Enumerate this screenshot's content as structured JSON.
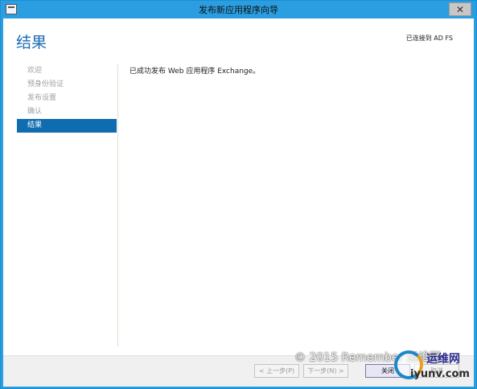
{
  "window": {
    "title": "发布新应用程序向导",
    "close_glyph": "✕"
  },
  "header": {
    "page_title": "结果",
    "connection_status": "已连接到 AD FS"
  },
  "nav": {
    "items": [
      {
        "label": "欢迎",
        "active": false
      },
      {
        "label": "预身份验证",
        "active": false
      },
      {
        "label": "发布设置",
        "active": false
      },
      {
        "label": "确认",
        "active": false
      },
      {
        "label": "结果",
        "active": true
      }
    ]
  },
  "main": {
    "message": "已成功发布 Web 应用程序 Exchange。"
  },
  "footer": {
    "prev_label": "< 上一步(P)",
    "next_label": "下一步(N) >",
    "close_label": "关闭",
    "cancel_label": "取消"
  },
  "watermark": {
    "text": "© 2015 Remember 运维网",
    "logo_cn": "运维网",
    "logo_url": "iyunv.com"
  },
  "colors": {
    "accent": "#0f6cb0",
    "title_blue": "#1c6cb3",
    "frame": "#2a9ee0"
  }
}
